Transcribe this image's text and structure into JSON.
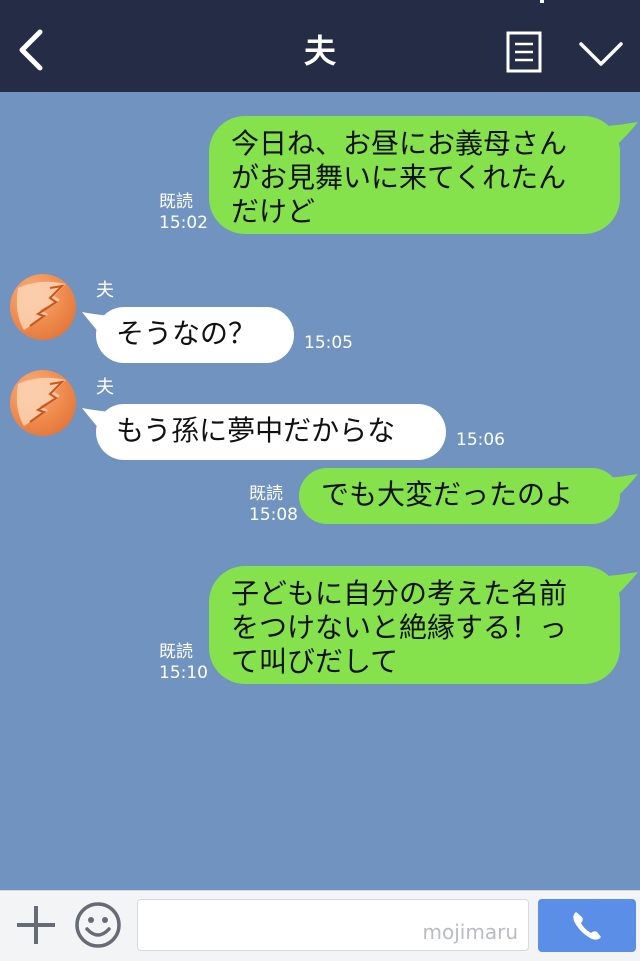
{
  "header": {
    "title": "夫",
    "colors": {
      "background": "#242d45",
      "text": "#ffffff"
    },
    "icons": [
      "chevron-left-icon",
      "notes-icon",
      "chevron-down-icon"
    ]
  },
  "chat": {
    "background": "#7193c0",
    "messages": [
      {
        "side": "out",
        "text": "今日ね、お昼にお義母さん\nがお見舞いに来てくれたん\nだけど",
        "read": "既読",
        "time": "15:02"
      },
      {
        "side": "in",
        "sender": "夫",
        "text": "そうなの？",
        "time": "15:05"
      },
      {
        "side": "in",
        "sender": "夫",
        "text": "もう孫に夢中だからな",
        "time": "15:06"
      },
      {
        "side": "out",
        "text": "でも大変だったのよ",
        "read": "既読",
        "time": "15:08"
      },
      {
        "side": "out",
        "text": "子どもに自分の考えた名前\nをつけないと絶縁する！っ\nて叫びだして",
        "read": "既読",
        "time": "15:10"
      }
    ],
    "colors": {
      "outgoing": "#85e24d",
      "incoming": "#ffffff"
    }
  },
  "input_bar": {
    "watermark": "mojimaru",
    "call_color": "#5b8ee6",
    "icons": [
      "plus-icon",
      "smiley-icon",
      "phone-icon"
    ]
  }
}
